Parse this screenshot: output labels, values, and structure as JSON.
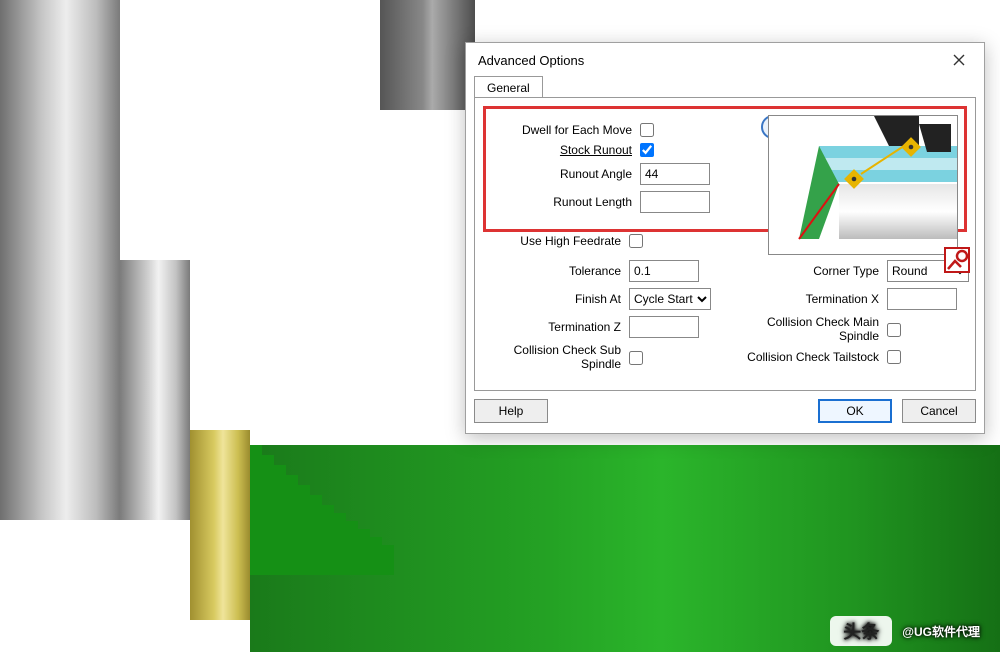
{
  "dialog": {
    "title": "Advanced Options",
    "tab_general": "General",
    "help_tooltip": "?",
    "fields": {
      "dwell_each_move_label": "Dwell for Each Move",
      "dwell_each_move_checked": false,
      "stock_runout_label": "Stock Runout",
      "stock_runout_checked": true,
      "runout_angle_label": "Runout Angle",
      "runout_angle_value": "44",
      "runout_length_label": "Runout Length",
      "runout_length_value": "",
      "use_high_feedrate_label": "Use High Feedrate",
      "use_high_feedrate_checked": false,
      "tolerance_label": "Tolerance",
      "tolerance_value": "0.1",
      "finish_at_label": "Finish At",
      "finish_at_value": "Cycle Start",
      "termination_z_label": "Termination Z",
      "termination_z_value": "",
      "ccheck_sub_label": "Collision Check Sub Spindle",
      "ccheck_sub_checked": false,
      "corner_type_label": "Corner Type",
      "corner_type_value": "Round",
      "termination_x_label": "Termination X",
      "termination_x_value": "",
      "ccheck_main_label": "Collision Check Main Spindle",
      "ccheck_main_checked": false,
      "ccheck_tail_label": "Collision Check Tailstock",
      "ccheck_tail_checked": false
    },
    "buttons": {
      "help": "Help",
      "ok": "OK",
      "cancel": "Cancel"
    }
  },
  "watermark": {
    "badge": "头条",
    "text": "@UG软件代理"
  }
}
